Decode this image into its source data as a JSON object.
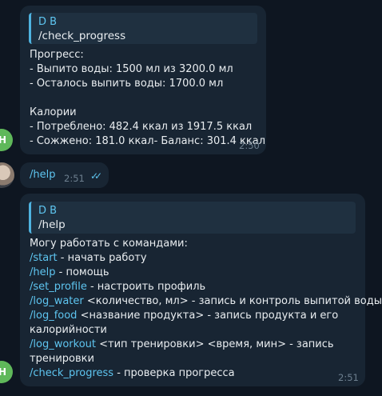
{
  "bot_avatar_letter": "Н",
  "message1": {
    "reply_name": "D B",
    "reply_text": "/check_progress",
    "lines": [
      "Прогресс:",
      "- Выпито воды: 1500 мл из 3200.0 мл",
      "- Осталось выпить воды: 1700.0 мл",
      "",
      "Калории",
      "- Потреблено: 482.4 ккал из 1917.5 ккал",
      "- Сожжено: 181.0 ккал- Баланс: 301.4 ккал"
    ],
    "time": "2:50"
  },
  "message2": {
    "text": "/help",
    "time": "2:51",
    "status_icon": "double-check-icon"
  },
  "message3": {
    "reply_name": "D B",
    "reply_text": "/help",
    "intro": "Могу работать с командами:",
    "commands": [
      {
        "cmd": "/start",
        "desc": " - начать работу"
      },
      {
        "cmd": "/help",
        "desc": " - помощь"
      },
      {
        "cmd": "/set_profile",
        "desc": " - настроить профиль"
      },
      {
        "cmd": "/log_water",
        "desc": " <количество, мл> - запись и контроль выпитой воды"
      },
      {
        "cmd": "/log_food",
        "desc": " <название продукта> - запись продукта и его"
      },
      {
        "cmd": "",
        "desc": "калорийности"
      },
      {
        "cmd": "/log_workout",
        "desc": " <тип тренировки> <время, мин> - запись"
      },
      {
        "cmd": "",
        "desc": "тренировки"
      },
      {
        "cmd": "/check_progress",
        "desc": " - проверка прогресса"
      }
    ],
    "time": "2:51"
  },
  "colors": {
    "background": "#0e1621",
    "bubble": "#182533",
    "accent": "#5ec5f0",
    "bot_avatar": "#5fb85a"
  }
}
